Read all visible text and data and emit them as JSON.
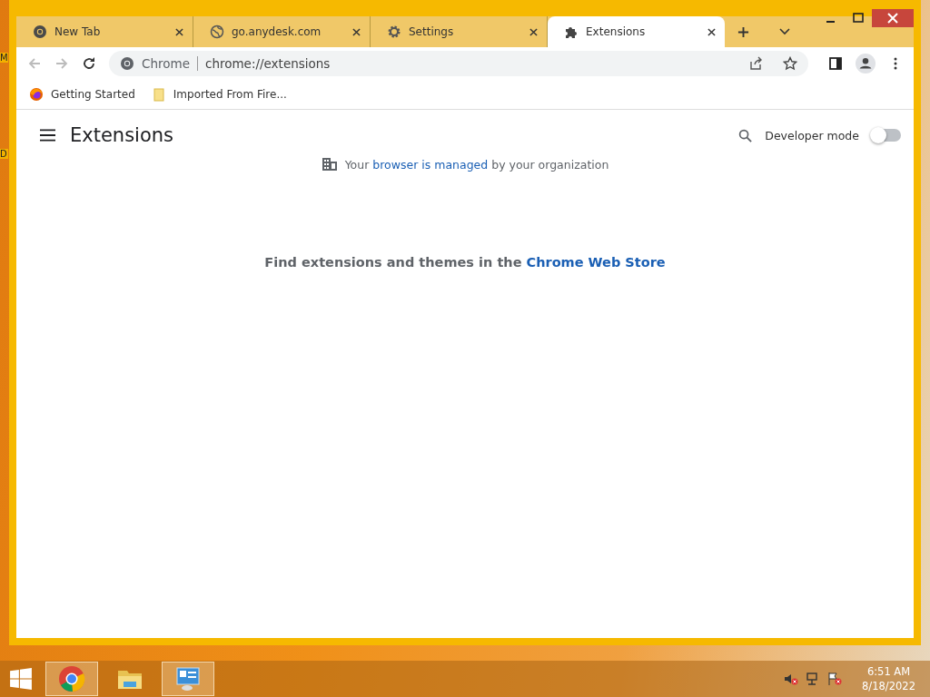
{
  "desktop_edge_labels": [
    "M",
    "D"
  ],
  "tabs": [
    {
      "title": "New Tab",
      "kind": "chrome",
      "selected": false
    },
    {
      "title": "go.anydesk.com",
      "kind": "globe",
      "selected": false
    },
    {
      "title": "Settings",
      "kind": "gear",
      "selected": false
    },
    {
      "title": "Extensions",
      "kind": "puzzle",
      "selected": true
    }
  ],
  "toolbar": {
    "site_chip": "Chrome",
    "url": "chrome://extensions"
  },
  "bookmarks": [
    {
      "label": "Getting Started",
      "kind": "firefox"
    },
    {
      "label": "Imported From Fire...",
      "kind": "folder"
    }
  ],
  "page": {
    "title": "Extensions",
    "developer_mode": {
      "label": "Developer mode",
      "on": false
    },
    "managed_notice": {
      "before": "Your",
      "link": "browser is managed",
      "after": "by your organization"
    },
    "store_prompt": {
      "text": "Find extensions and themes in the",
      "link": "Chrome Web Store"
    }
  },
  "taskbar": {
    "apps": [
      {
        "kind": "chrome",
        "active": true
      },
      {
        "kind": "explorer",
        "active": false
      },
      {
        "kind": "control-panel",
        "active": true
      }
    ],
    "time": "6:51 AM",
    "date": "8/18/2022"
  }
}
